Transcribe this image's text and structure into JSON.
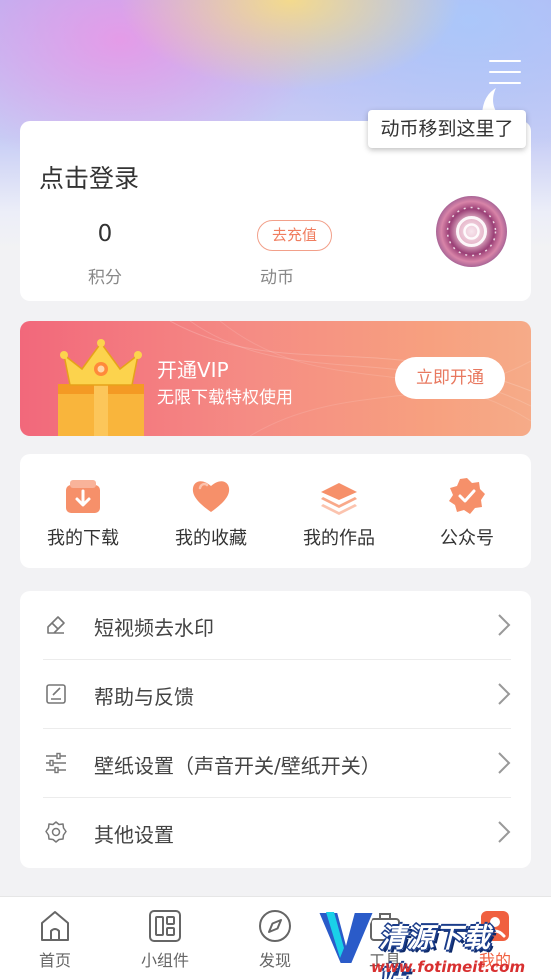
{
  "header": {
    "tooltip": "动币移到这里了"
  },
  "profile": {
    "login_prompt": "点击登录",
    "points_value": "0",
    "points_label": "积分",
    "recharge_label": "去充值",
    "coins_label": "动币"
  },
  "vip": {
    "title": "开通VIP",
    "subtitle": "无限下载特权使用",
    "button": "立即开通"
  },
  "quick_actions": [
    {
      "label": "我的下载",
      "icon": "download-box-icon"
    },
    {
      "label": "我的收藏",
      "icon": "heart-icon"
    },
    {
      "label": "我的作品",
      "icon": "layers-icon"
    },
    {
      "label": "公众号",
      "icon": "verified-badge-icon"
    }
  ],
  "menu": [
    {
      "label": "短视频去水印",
      "icon": "eraser-icon"
    },
    {
      "label": "帮助与反馈",
      "icon": "edit-note-icon"
    },
    {
      "label": "壁纸设置（声音开关/壁纸开关）",
      "icon": "sliders-icon"
    },
    {
      "label": "其他设置",
      "icon": "gear-icon"
    }
  ],
  "tabbar": [
    {
      "label": "首页",
      "icon": "home-icon"
    },
    {
      "label": "小组件",
      "icon": "widget-icon"
    },
    {
      "label": "发现",
      "icon": "compass-icon"
    },
    {
      "label": "工具",
      "icon": "toolbox-icon"
    },
    {
      "label": "我的",
      "icon": "profile-icon"
    }
  ],
  "watermark": {
    "brand": "清源下载站",
    "url": "www.fotimeit.com"
  },
  "colors": {
    "accent": "#f06040",
    "vip_gradient_start": "#f2687b",
    "vip_gradient_end": "#f6ab88",
    "icon_orange": "#f6906a"
  }
}
